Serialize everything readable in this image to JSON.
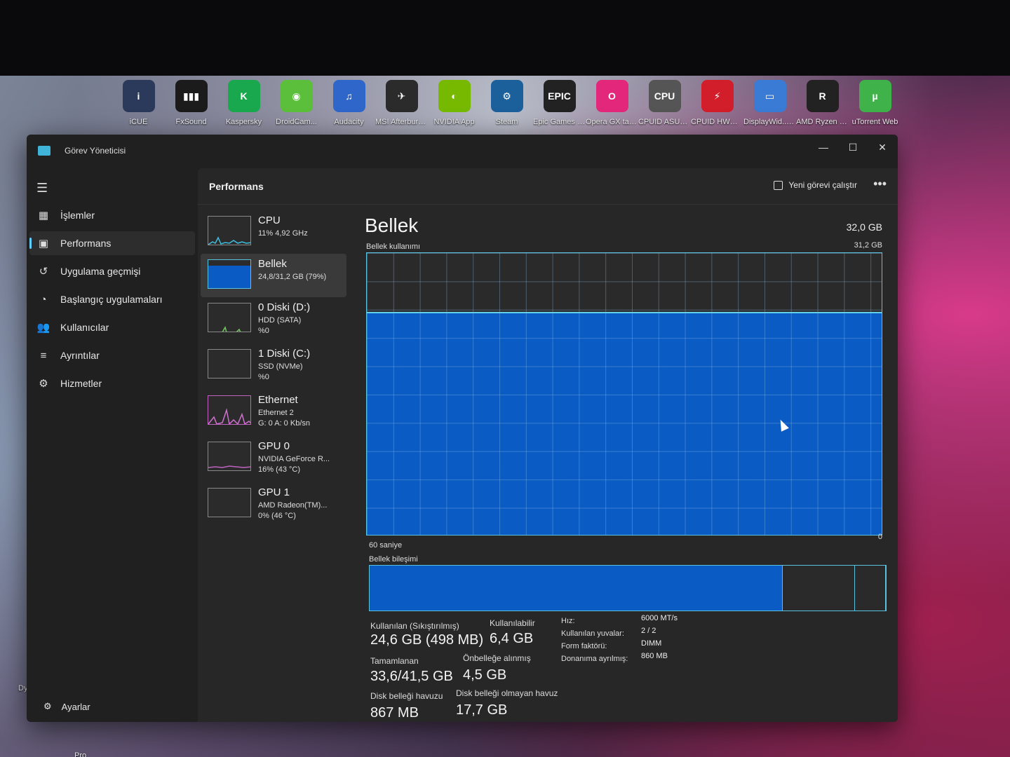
{
  "desktop": {
    "icons": [
      {
        "label": "iCUE",
        "glyph": "i",
        "color": "#2b3a5a"
      },
      {
        "label": "FxSound",
        "glyph": "▮▮▮",
        "color": "#1b1b1b"
      },
      {
        "label": "Kaspersky",
        "glyph": "K",
        "color": "#19a84d"
      },
      {
        "label": "DroidCam...",
        "glyph": "◉",
        "color": "#5bbf3c"
      },
      {
        "label": "Audacity",
        "glyph": "♫",
        "color": "#2f66c9"
      },
      {
        "label": "MSI Afterburner",
        "glyph": "✈",
        "color": "#2b2b2b"
      },
      {
        "label": "NVIDIA App",
        "glyph": "◐",
        "color": "#76b900"
      },
      {
        "label": "Steam",
        "glyph": "⚙",
        "color": "#1b5f9b"
      },
      {
        "label": "Epic Games Launcher",
        "glyph": "EPIC",
        "color": "#222"
      },
      {
        "label": "Opera GX tarayıcı",
        "glyph": "O",
        "color": "#e3277a"
      },
      {
        "label": "CPUID ASUS GPU-Z",
        "glyph": "CPU",
        "color": "#555"
      },
      {
        "label": "CPUID HWMonitor",
        "glyph": "⚡",
        "color": "#d21e2b"
      },
      {
        "label": "DisplayWid... Center",
        "glyph": "▭",
        "color": "#3a7bd5"
      },
      {
        "label": "AMD Ryzen Master",
        "glyph": "R",
        "color": "#222"
      },
      {
        "label": "uTorrent Web",
        "glyph": "µ",
        "color": "#3fb24a"
      }
    ],
    "left_icons": [
      {
        "label": "Dyir"
      },
      {
        "label": "Pro Soccer"
      }
    ]
  },
  "window": {
    "title": "Görev Yöneticisi",
    "controls": {
      "minimize": "—",
      "maximize": "☐",
      "close": "✕"
    }
  },
  "nav": {
    "menu_icon": "☰",
    "items": [
      {
        "label": "İşlemler",
        "icon": "▦"
      },
      {
        "label": "Performans",
        "icon": "▣"
      },
      {
        "label": "Uygulama geçmişi",
        "icon": "↺"
      },
      {
        "label": "Başlangıç uygulamaları",
        "icon": "◔"
      },
      {
        "label": "Kullanıcılar",
        "icon": "👥"
      },
      {
        "label": "Ayrıntılar",
        "icon": "≡"
      },
      {
        "label": "Hizmetler",
        "icon": "⚙"
      }
    ],
    "settings": {
      "label": "Ayarlar",
      "icon": "⚙"
    }
  },
  "main": {
    "title": "Performans",
    "run_task": "Yeni görevi çalıştır",
    "more": "•••"
  },
  "devices": [
    {
      "name": "CPU",
      "sub1": "11% 4,92 GHz",
      "sub2": ""
    },
    {
      "name": "Bellek",
      "sub1": "24,8/31,2 GB (79%)",
      "sub2": ""
    },
    {
      "name": "0 Diski (D:)",
      "sub1": "HDD (SATA)",
      "sub2": "%0"
    },
    {
      "name": "1 Diski (C:)",
      "sub1": "SSD (NVMe)",
      "sub2": "%0"
    },
    {
      "name": "Ethernet",
      "sub1": "Ethernet 2",
      "sub2": "G: 0 A: 0 Kb/sn"
    },
    {
      "name": "GPU 0",
      "sub1": "NVIDIA GeForce R...",
      "sub2": "16% (43 °C)"
    },
    {
      "name": "GPU 1",
      "sub1": "AMD Radeon(TM)...",
      "sub2": "0% (46 °C)"
    }
  ],
  "detail": {
    "title": "Bellek",
    "total": "32,0 GB",
    "usage_label": "Bellek kullanımı",
    "usage_max": "31,2 GB",
    "usage_fraction": 0.79,
    "axis_left": "60 saniye",
    "axis_right": "0",
    "composition_label": "Bellek bileşimi",
    "composition": [
      0.8,
      0.14,
      0.06
    ],
    "stats": {
      "used_label": "Kullanılan (Sıkıştırılmış)",
      "used_value": "24,6 GB (498 MB)",
      "available_label": "Kullanılabilir",
      "available_value": "6,4 GB",
      "committed_label": "Tamamlanan",
      "committed_value": "33,6/41,5 GB",
      "cached_label": "Önbelleğe alınmış",
      "cached_value": "4,5 GB",
      "paged_label": "Disk belleği havuzu",
      "paged_value": "867 MB",
      "nonpaged_label": "Disk belleği olmayan havuz",
      "nonpaged_value": "17,7 GB"
    },
    "specs": [
      {
        "label": "Hız:",
        "value": "6000 MT/s"
      },
      {
        "label": "Kullanılan yuvalar:",
        "value": "2 / 2"
      },
      {
        "label": "Form faktörü:",
        "value": "DIMM"
      },
      {
        "label": "Donanıma ayrılmış:",
        "value": "860 MB"
      }
    ]
  },
  "colors": {
    "accent": "#60cdff",
    "graph_fill": "#0b5bc4",
    "graph_border": "#58c2e0"
  }
}
